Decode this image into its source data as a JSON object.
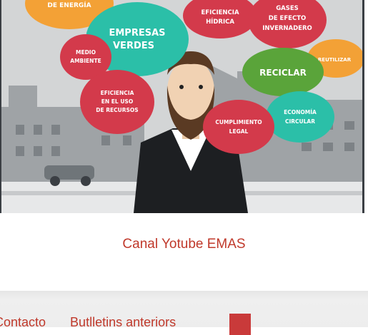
{
  "video": {
    "bubbles": {
      "energia": "DE ENERGÍA",
      "eficiencia_hidrica_1": "EFICIENCIA",
      "eficiencia_hidrica_2": "HÍDRICA",
      "gases_1": "GASES",
      "gases_2": "DE EFECTO",
      "gases_3": "INVERNADERO",
      "empresas_1": "EMPRESAS",
      "empresas_2": "VERDES",
      "medio_1": "MEDIO",
      "medio_2": "AMBIENTE",
      "reutilizar": "REUTILIZAR",
      "reciclar": "RECICLAR",
      "recursos_1": "EFICIENCIA",
      "recursos_2": "EN EL USO",
      "recursos_3": "DE RECURSOS",
      "economia_1": "ECONOMÍA",
      "economia_2": "CIRCULAR",
      "cumplimiento_1": "CUMPLIMIENTO",
      "cumplimiento_2": "LEGAL"
    }
  },
  "caption": "Canal Yotube EMAS",
  "footer": {
    "links": [
      "Contacto",
      "Butlletins anteriors"
    ]
  },
  "colors": {
    "accent": "#c0392b",
    "red_bubble": "#d33a4b",
    "teal_bubble": "#2bbfa8",
    "orange_bubble": "#f3a136",
    "green_bubble": "#5aa43a"
  }
}
